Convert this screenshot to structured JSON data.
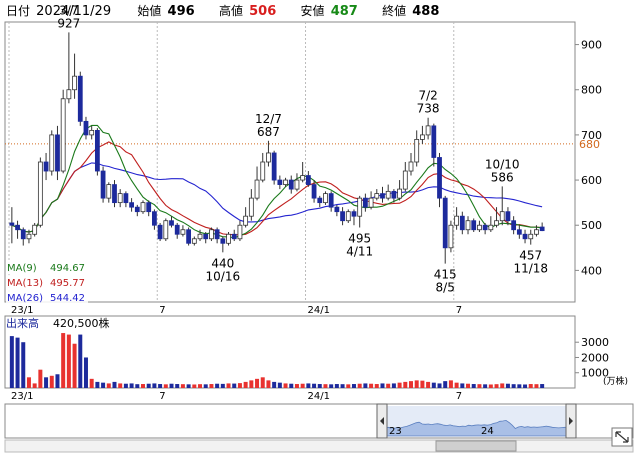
{
  "header": {
    "date_label": "日付",
    "date_value": "2024/11/29",
    "open_label": "始値",
    "open_value": "496",
    "high_label": "高値",
    "high_value": "506",
    "low_label": "安値",
    "low_value": "487",
    "close_label": "終値",
    "close_value": "488"
  },
  "colors": {
    "up": "#e8322f",
    "down": "#1d2a9c",
    "ma9": "#1b7a1b",
    "ma13": "#c0201f",
    "ma26": "#2424d0",
    "high_text": "#d81e1e",
    "low_text": "#178a17",
    "price_line": "#d2691e"
  },
  "chart_data": [
    {
      "type": "candlestick",
      "y_ticks": [
        900,
        800,
        700,
        600,
        500,
        400
      ],
      "ylim": [
        330,
        950
      ],
      "x_ticks": [
        "23/1",
        "7",
        "24/1",
        "7"
      ],
      "current_price_line": 680,
      "current_price_label": "680",
      "legend": [
        {
          "label": "MA(9)",
          "value": "494.67"
        },
        {
          "label": "MA(13)",
          "value": "495.77"
        },
        {
          "label": "MA(26)",
          "value": "544.42"
        }
      ],
      "annotations": [
        {
          "date": "3/7",
          "value": "927",
          "index": 10,
          "pos": "above"
        },
        {
          "date": "10/16",
          "value": "440",
          "index": 37,
          "pos": "below"
        },
        {
          "date": "12/7",
          "value": "687",
          "index": 45,
          "pos": "above"
        },
        {
          "date": "4/11",
          "value": "495",
          "index": 61,
          "pos": "below"
        },
        {
          "date": "7/2",
          "value": "738",
          "index": 73,
          "pos": "above"
        },
        {
          "date": "8/5",
          "value": "415",
          "index": 76,
          "pos": "below"
        },
        {
          "date": "10/10",
          "value": "586",
          "index": 86,
          "pos": "above"
        },
        {
          "date": "11/18",
          "value": "457",
          "index": 91,
          "pos": "below"
        }
      ],
      "candles": [
        [
          505,
          500,
          540,
          460
        ],
        [
          500,
          490,
          510,
          470
        ],
        [
          490,
          470,
          495,
          455
        ],
        [
          470,
          480,
          490,
          460
        ],
        [
          480,
          500,
          505,
          475
        ],
        [
          500,
          640,
          650,
          495
        ],
        [
          640,
          620,
          660,
          600
        ],
        [
          620,
          700,
          710,
          610
        ],
        [
          700,
          620,
          720,
          600
        ],
        [
          620,
          780,
          800,
          615
        ],
        [
          780,
          800,
          927,
          770
        ],
        [
          800,
          830,
          880,
          780
        ],
        [
          830,
          730,
          840,
          720
        ],
        [
          730,
          700,
          740,
          690
        ],
        [
          700,
          710,
          720,
          690
        ],
        [
          710,
          620,
          715,
          610
        ],
        [
          620,
          560,
          630,
          550
        ],
        [
          560,
          590,
          595,
          550
        ],
        [
          590,
          550,
          600,
          540
        ],
        [
          550,
          570,
          580,
          540
        ],
        [
          570,
          550,
          575,
          540
        ],
        [
          550,
          540,
          560,
          530
        ],
        [
          540,
          530,
          545,
          520
        ],
        [
          530,
          550,
          555,
          525
        ],
        [
          550,
          530,
          555,
          520
        ],
        [
          530,
          500,
          535,
          490
        ],
        [
          500,
          470,
          505,
          465
        ],
        [
          470,
          510,
          515,
          465
        ],
        [
          510,
          500,
          520,
          495
        ],
        [
          500,
          480,
          505,
          470
        ],
        [
          480,
          490,
          500,
          475
        ],
        [
          490,
          460,
          495,
          455
        ],
        [
          460,
          470,
          475,
          455
        ],
        [
          470,
          480,
          490,
          465
        ],
        [
          480,
          470,
          485,
          460
        ],
        [
          470,
          490,
          495,
          465
        ],
        [
          490,
          470,
          495,
          460
        ],
        [
          470,
          460,
          475,
          440
        ],
        [
          460,
          480,
          485,
          455
        ],
        [
          480,
          470,
          490,
          465
        ],
        [
          470,
          500,
          510,
          465
        ],
        [
          500,
          520,
          540,
          495
        ],
        [
          520,
          560,
          580,
          510
        ],
        [
          560,
          600,
          630,
          555
        ],
        [
          600,
          640,
          660,
          595
        ],
        [
          640,
          660,
          687,
          630
        ],
        [
          660,
          600,
          665,
          590
        ],
        [
          600,
          590,
          610,
          580
        ],
        [
          590,
          600,
          605,
          585
        ],
        [
          600,
          580,
          610,
          570
        ],
        [
          580,
          600,
          615,
          575
        ],
        [
          600,
          610,
          640,
          595
        ],
        [
          610,
          590,
          620,
          585
        ],
        [
          590,
          560,
          600,
          550
        ],
        [
          560,
          550,
          565,
          540
        ],
        [
          550,
          570,
          575,
          545
        ],
        [
          570,
          540,
          575,
          530
        ],
        [
          540,
          530,
          545,
          520
        ],
        [
          530,
          510,
          540,
          500
        ],
        [
          510,
          530,
          535,
          505
        ],
        [
          530,
          520,
          535,
          500
        ],
        [
          520,
          560,
          565,
          495
        ],
        [
          560,
          540,
          570,
          530
        ],
        [
          540,
          560,
          575,
          535
        ],
        [
          560,
          570,
          580,
          555
        ],
        [
          570,
          560,
          585,
          550
        ],
        [
          560,
          575,
          590,
          555
        ],
        [
          575,
          560,
          580,
          550
        ],
        [
          560,
          580,
          600,
          555
        ],
        [
          580,
          620,
          640,
          575
        ],
        [
          620,
          640,
          660,
          610
        ],
        [
          640,
          690,
          710,
          630
        ],
        [
          690,
          700,
          720,
          680
        ],
        [
          700,
          720,
          738,
          690
        ],
        [
          720,
          650,
          725,
          630
        ],
        [
          650,
          560,
          660,
          540
        ],
        [
          560,
          450,
          565,
          415
        ],
        [
          450,
          500,
          510,
          440
        ],
        [
          500,
          520,
          540,
          490
        ],
        [
          520,
          490,
          530,
          480
        ],
        [
          490,
          510,
          520,
          480
        ],
        [
          510,
          490,
          515,
          485
        ],
        [
          490,
          500,
          510,
          485
        ],
        [
          500,
          490,
          505,
          480
        ],
        [
          490,
          500,
          520,
          485
        ],
        [
          500,
          510,
          540,
          495
        ],
        [
          510,
          530,
          586,
          500
        ],
        [
          530,
          510,
          540,
          500
        ],
        [
          510,
          490,
          520,
          480
        ],
        [
          490,
          480,
          500,
          470
        ],
        [
          480,
          470,
          490,
          460
        ],
        [
          470,
          480,
          490,
          457
        ],
        [
          480,
          490,
          500,
          475
        ],
        [
          496,
          488,
          506,
          487
        ]
      ],
      "volume_ticks": [
        3000,
        2000,
        1000
      ],
      "volume_unit": "(万株)",
      "volume_label": "出来高",
      "volume_value": "420,500株",
      "volumes": [
        3400,
        3300,
        3000,
        700,
        300,
        1200,
        700,
        800,
        900,
        3600,
        3500,
        2900,
        3500,
        2000,
        600,
        400,
        350,
        300,
        400,
        300,
        280,
        300,
        250,
        260,
        280,
        300,
        260,
        240,
        280,
        260,
        250,
        240,
        230,
        250,
        240,
        260,
        280,
        270,
        300,
        290,
        320,
        400,
        500,
        600,
        700,
        500,
        400,
        350,
        300,
        280,
        260,
        280,
        300,
        280,
        260,
        250,
        240,
        260,
        250,
        240,
        260,
        280,
        300,
        280,
        260,
        300,
        280,
        300,
        350,
        400,
        450,
        500,
        480,
        400,
        350,
        300,
        450,
        500,
        350,
        300,
        280,
        260,
        250,
        240,
        230,
        250,
        300,
        280,
        250,
        240,
        230,
        260,
        250,
        260
      ],
      "volume_ylim": [
        0,
        3800
      ],
      "navigator_labels": [
        "23",
        "24"
      ],
      "navigator_x_ticks": [
        "23/1",
        "7",
        "24/1",
        "7"
      ]
    }
  ]
}
